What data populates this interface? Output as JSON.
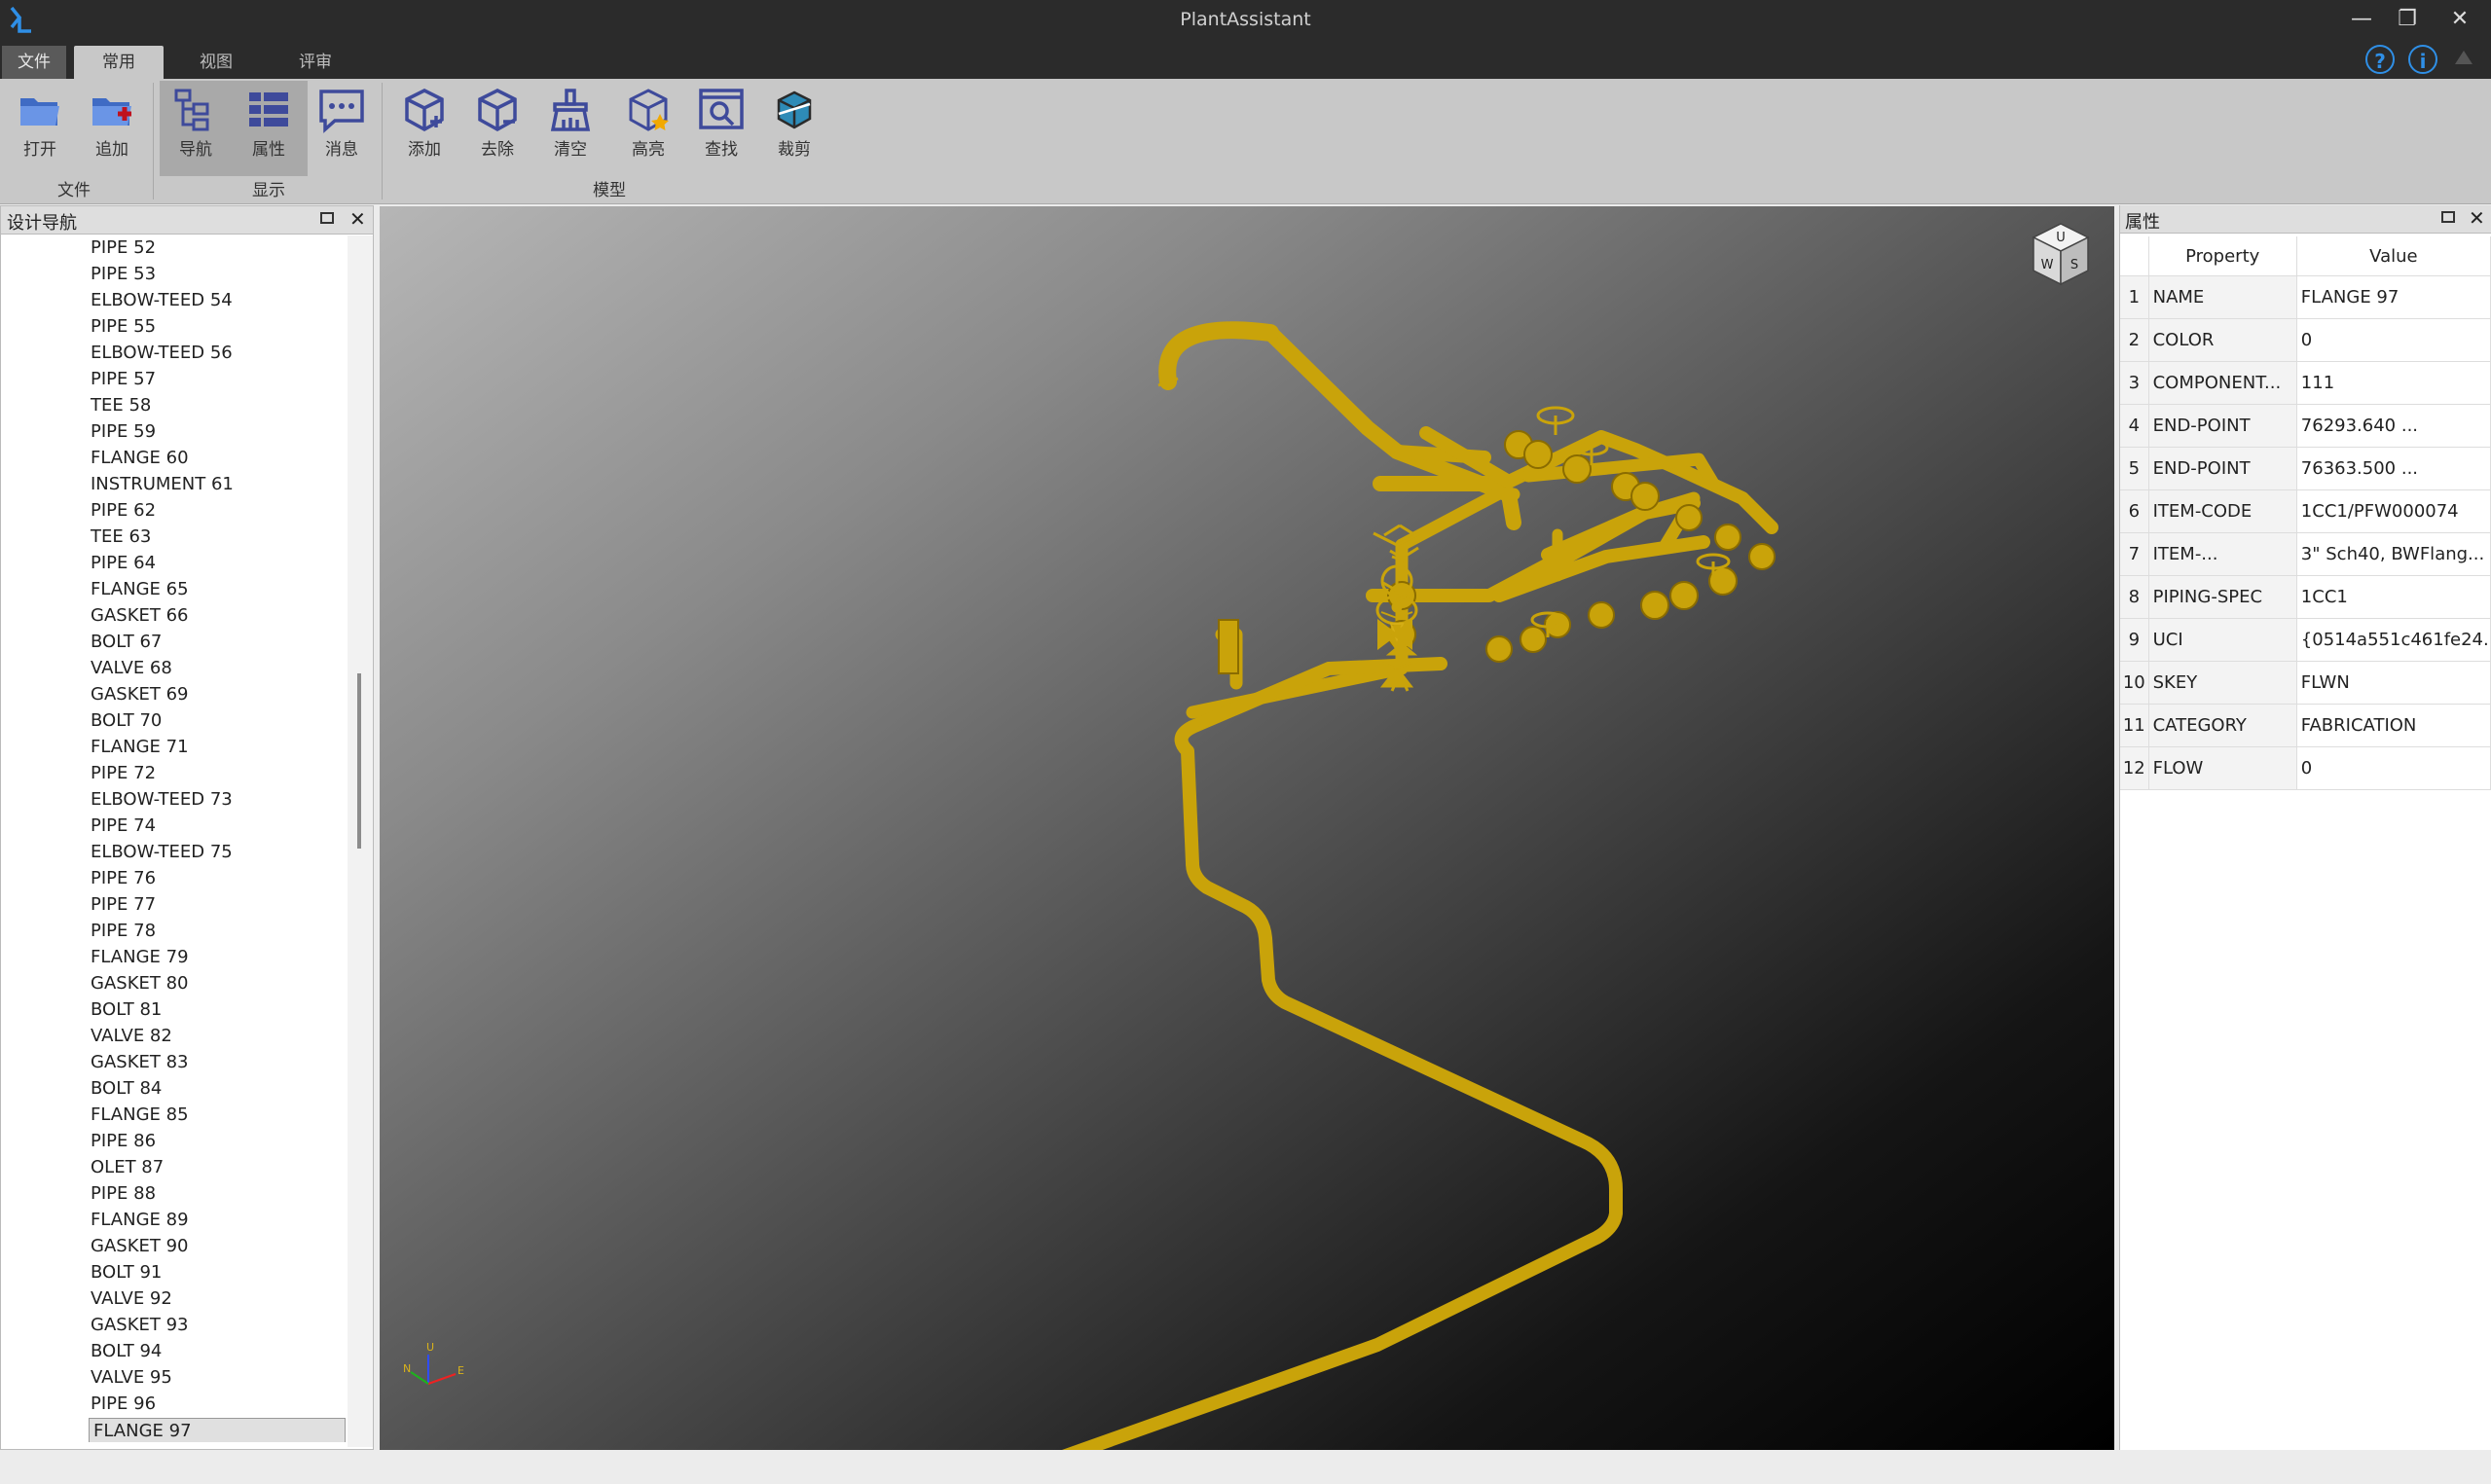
{
  "window": {
    "title": "PlantAssistant",
    "minimize": "—",
    "restore": "❐",
    "close": "✕"
  },
  "tabs": {
    "file": "文件",
    "common": "常用",
    "view": "视图",
    "review": "评审"
  },
  "help": {
    "help": "?",
    "info": "i"
  },
  "ribbon": {
    "open": "打开",
    "append": "追加",
    "file_group": "文件",
    "nav": "导航",
    "props": "属性",
    "message": "消息",
    "display_group": "显示",
    "add": "添加",
    "remove": "去除",
    "clear": "清空",
    "highlight": "高亮",
    "find": "查找",
    "clip": "裁剪",
    "model_group": "模型"
  },
  "nav_panel": {
    "title": "设计导航",
    "items": [
      "PIPE 52",
      "PIPE 53",
      "ELBOW-TEED 54",
      "PIPE 55",
      "ELBOW-TEED 56",
      "PIPE 57",
      "TEE 58",
      "PIPE 59",
      "FLANGE 60",
      "INSTRUMENT 61",
      "PIPE 62",
      "TEE 63",
      "PIPE 64",
      "FLANGE 65",
      "GASKET 66",
      "BOLT 67",
      "VALVE 68",
      "GASKET 69",
      "BOLT 70",
      "FLANGE 71",
      "PIPE 72",
      "ELBOW-TEED 73",
      "PIPE 74",
      "ELBOW-TEED 75",
      "PIPE 76",
      "PIPE 77",
      "PIPE 78",
      "FLANGE 79",
      "GASKET 80",
      "BOLT 81",
      "VALVE 82",
      "GASKET 83",
      "BOLT 84",
      "FLANGE 85",
      "PIPE 86",
      "OLET 87",
      "PIPE 88",
      "FLANGE 89",
      "GASKET 90",
      "BOLT 91",
      "VALVE 92",
      "GASKET 93",
      "BOLT 94",
      "VALVE 95",
      "PIPE 96",
      "FLANGE 97"
    ],
    "selected": "FLANGE 97"
  },
  "viewcube": {
    "top": "U",
    "west": "W",
    "south": "S"
  },
  "axes": {
    "up": "U",
    "north": "N",
    "east": "E"
  },
  "prop_panel": {
    "title": "属性",
    "col_property": "Property",
    "col_value": "Value",
    "rows": [
      {
        "n": "1",
        "p": "NAME",
        "v": "FLANGE 97"
      },
      {
        "n": "2",
        "p": "COLOR",
        "v": "0"
      },
      {
        "n": "3",
        "p": "COMPONENT...",
        "v": "111"
      },
      {
        "n": "4",
        "p": "END-POINT",
        "v": "76293.640   ..."
      },
      {
        "n": "5",
        "p": "END-POINT",
        "v": "76363.500   ..."
      },
      {
        "n": "6",
        "p": "ITEM-CODE",
        "v": "1CC1/PFW000074"
      },
      {
        "n": "7",
        "p": "ITEM-...",
        "v": "3\" Sch40, BWFlang..."
      },
      {
        "n": "8",
        "p": "PIPING-SPEC",
        "v": "1CC1"
      },
      {
        "n": "9",
        "p": "UCI",
        "v": "{0514a551c461fe24..."
      },
      {
        "n": "10",
        "p": "SKEY",
        "v": "FLWN"
      },
      {
        "n": "11",
        "p": "CATEGORY",
        "v": "FABRICATION"
      },
      {
        "n": "12",
        "p": "FLOW",
        "v": "0"
      }
    ]
  },
  "colors": {
    "pipe": "#c9a30a",
    "accent": "#2f8fe6",
    "icon": "#3e4a9b"
  }
}
